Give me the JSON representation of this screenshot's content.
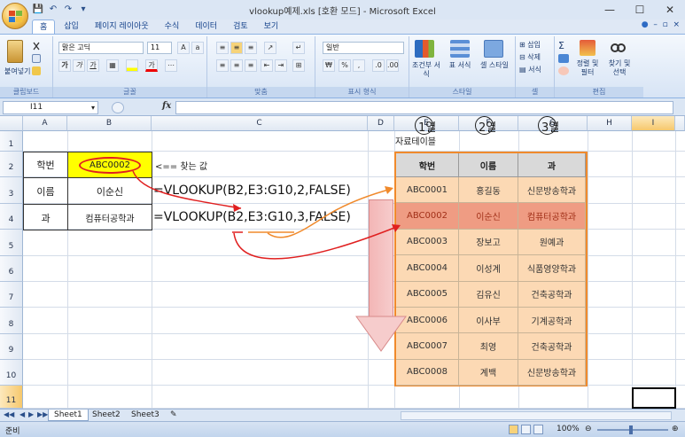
{
  "window": {
    "title": "vlookup예제.xls  [호환 모드] - Microsoft Excel",
    "minimize": "—",
    "maximize": "☐",
    "close": "✕"
  },
  "ribbon_tabs": [
    "홈",
    "삽입",
    "페이지 레이아웃",
    "수식",
    "데이터",
    "검토",
    "보기"
  ],
  "ribbon": {
    "clipboard": {
      "paste_label": "붙여넣기",
      "group_label": "클립보드"
    },
    "font": {
      "font_name": "맑은 고딕",
      "font_size": "11",
      "bold": "가",
      "italic": "가",
      "underline": "가",
      "font_color": "가",
      "group_label": "글꼴"
    },
    "alignment": {
      "group_label": "맞춤"
    },
    "number": {
      "format": "일반",
      "currency": "₩",
      "percent": "%",
      "comma": ",",
      "group_label": "표시 형식"
    },
    "styles": {
      "conditional": "조건부 서식",
      "table": "표 서식",
      "cell": "셀 스타일",
      "group_label": "스타일"
    },
    "cells": {
      "insert": "삽입",
      "delete": "삭제",
      "format": "서식",
      "group_label": "셀"
    },
    "editing": {
      "sum": "Σ",
      "sort": "정렬 및 필터",
      "find": "찾기 및 선택",
      "group_label": "편집"
    }
  },
  "formula_bar": {
    "name_box": "I11",
    "fx": "fx",
    "value": ""
  },
  "columns": [
    "A",
    "B",
    "C",
    "D",
    "E",
    "F",
    "G",
    "H",
    "I"
  ],
  "rows": [
    "1",
    "2",
    "3",
    "4",
    "5",
    "6",
    "7",
    "8",
    "9",
    "10",
    "11"
  ],
  "sheet": {
    "a2": "학번",
    "b2": "ABC0002",
    "c2": "<== 찾는 값",
    "a3": "이름",
    "b3": "이순신",
    "c3": "=VLOOKUP(B2,E3:G10,2,FALSE)",
    "a4": "과",
    "b4": "컴퓨터공학과",
    "c4": "=VLOOKUP(B2,E3:G10,3,FALSE)"
  },
  "lookup_table": {
    "caption": "자료테이블",
    "col_numbers": [
      "1열",
      "2열",
      "3열"
    ],
    "headers": [
      "학번",
      "이름",
      "과"
    ],
    "rows": [
      [
        "ABC0001",
        "홍길동",
        "신문방송학과"
      ],
      [
        "ABC0002",
        "이순신",
        "컴퓨터공학과"
      ],
      [
        "ABC0003",
        "장보고",
        "원예과"
      ],
      [
        "ABC0004",
        "이성계",
        "식품영양학과"
      ],
      [
        "ABC0005",
        "김유신",
        "건축공학과"
      ],
      [
        "ABC0006",
        "이사부",
        "기계공학과"
      ],
      [
        "ABC0007",
        "최영",
        "건축공학과"
      ],
      [
        "ABC0008",
        "계백",
        "신문방송학과"
      ]
    ]
  },
  "sheet_tabs": [
    "Sheet1",
    "Sheet2",
    "Sheet3"
  ],
  "status": {
    "mode": "준비",
    "zoom": "100%"
  },
  "colors": {
    "table_body": "#fcd9b4",
    "table_highlight": "#ef9c83",
    "table_border": "#f08a2c",
    "lookup_value_fill": "#ffff00",
    "arrow_red": "#e02020",
    "arrow_orange": "#f08a2c"
  }
}
